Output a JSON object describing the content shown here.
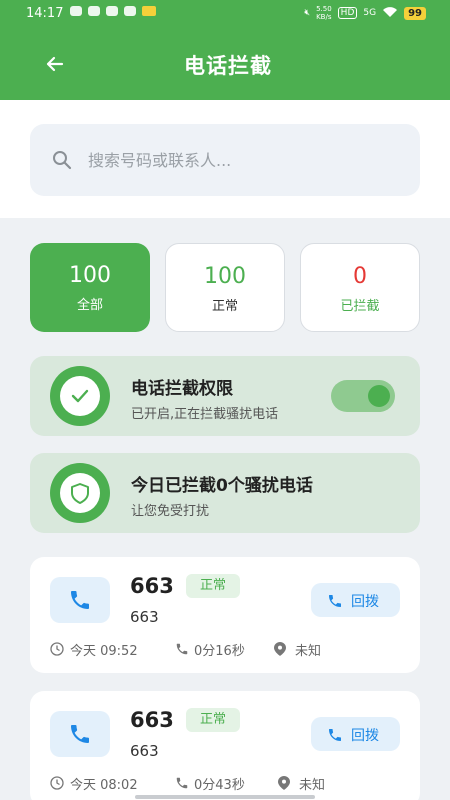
{
  "status_bar": {
    "time": "14:17",
    "network_speed": "5.50\nKB/s",
    "hd": "HD",
    "signal": "5G",
    "battery": "99"
  },
  "header": {
    "title": "电话拦截"
  },
  "search": {
    "placeholder": "搜索号码或联系人..."
  },
  "stats": [
    {
      "value": "100",
      "label": "全部"
    },
    {
      "value": "100",
      "label": "正常"
    },
    {
      "value": "0",
      "label": "已拦截"
    }
  ],
  "permission_card": {
    "title": "电话拦截权限",
    "subtitle": "已开启,正在拦截骚扰电话",
    "toggle_on": true
  },
  "today_card": {
    "title": "今日已拦截0个骚扰电话",
    "subtitle": "让您免受打扰"
  },
  "calls": [
    {
      "number": "663",
      "badge": "正常",
      "sub": "663",
      "redial": "回拨",
      "time": "今天 09:52",
      "duration": "0分16秒",
      "location": "未知"
    },
    {
      "number": "663",
      "badge": "正常",
      "sub": "663",
      "redial": "回拨",
      "time": "今天 08:02",
      "duration": "0分43秒",
      "location": "未知"
    }
  ],
  "colors": {
    "primary": "#4caf50",
    "blocked": "#e53935",
    "link": "#1e88e5"
  }
}
